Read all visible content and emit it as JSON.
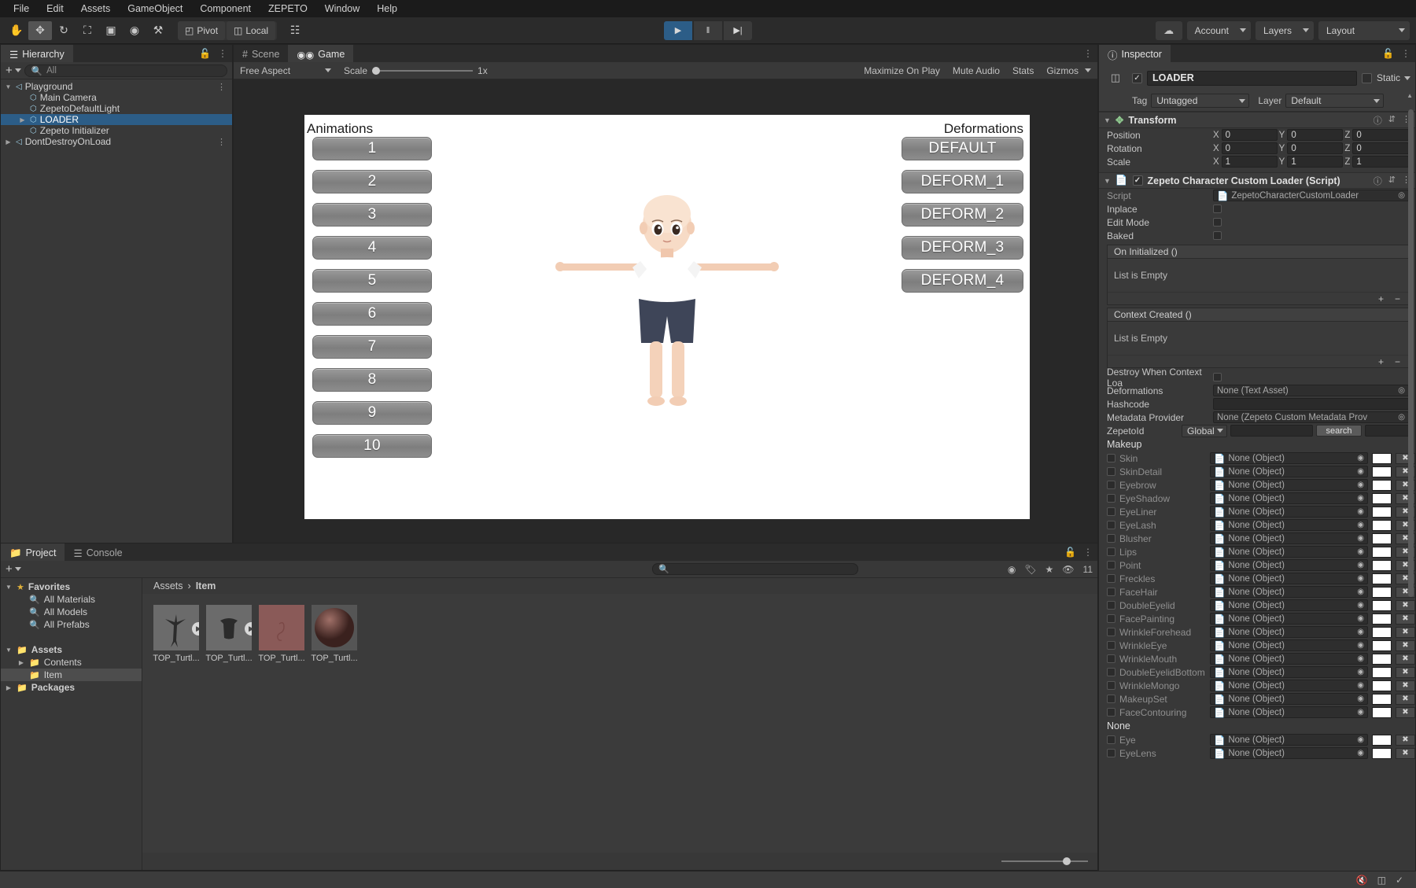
{
  "menu": {
    "items": [
      "File",
      "Edit",
      "Assets",
      "GameObject",
      "Component",
      "ZEPETO",
      "Window",
      "Help"
    ]
  },
  "toolbar": {
    "tools": [
      "hand-tool",
      "move-tool",
      "rotate-tool",
      "scale-tool",
      "rect-tool",
      "transform-tool",
      "custom-tool"
    ],
    "pivot_label": "Pivot",
    "local_label": "Local",
    "snap_label": "grid-snap",
    "play_label": "▶",
    "pause_label": "‖",
    "step_label": "▶|",
    "cloud_label": "cloud-icon",
    "account_label": "Account",
    "layers_label": "Layers",
    "layout_label": "Layout"
  },
  "hierarchy": {
    "tab_label": "Hierarchy",
    "search_placeholder": "All",
    "items": [
      {
        "label": "Playground",
        "depth": 1,
        "twisty": "▼",
        "icon": "scene-icon",
        "selected": false
      },
      {
        "label": "Main Camera",
        "depth": 2,
        "twisty": "",
        "icon": "gameobject-icon",
        "selected": false
      },
      {
        "label": "ZepetoDefaultLight",
        "depth": 2,
        "twisty": "",
        "icon": "gameobject-icon",
        "selected": false
      },
      {
        "label": "LOADER",
        "depth": 2,
        "twisty": "▶",
        "icon": "gameobject-icon",
        "selected": true
      },
      {
        "label": "Zepeto Initializer",
        "depth": 2,
        "twisty": "",
        "icon": "gameobject-icon",
        "selected": false
      },
      {
        "label": "DontDestroyOnLoad",
        "depth": 1,
        "twisty": "▶",
        "icon": "scene-icon",
        "selected": false
      }
    ]
  },
  "sceneview": {
    "tabs": [
      {
        "label": "Scene",
        "icon": "scene-hash-icon",
        "active": false
      },
      {
        "label": "Game",
        "icon": "game-pad-icon",
        "active": true
      }
    ],
    "aspect": "Free Aspect",
    "scale_label": "Scale",
    "scale_value": "1x",
    "right_items": [
      "Maximize On Play",
      "Mute Audio",
      "Stats",
      "Gizmos"
    ]
  },
  "game": {
    "animations_title": "Animations",
    "deformations_title": "Deformations",
    "animation_buttons": [
      "1",
      "2",
      "3",
      "4",
      "5",
      "6",
      "7",
      "8",
      "9",
      "10"
    ],
    "deform_buttons": [
      "DEFAULT",
      "DEFORM_1",
      "DEFORM_2",
      "DEFORM_3",
      "DEFORM_4"
    ]
  },
  "project": {
    "tabs": [
      {
        "label": "Project",
        "icon": "folder-icon",
        "active": true
      },
      {
        "label": "Console",
        "icon": "console-icon",
        "active": false
      }
    ],
    "search_placeholder": "",
    "hidden_count": "11",
    "tree": [
      {
        "label": "Favorites",
        "twisty": "▼",
        "icon": "star-icon",
        "depth": 0,
        "selected": false,
        "bold": true
      },
      {
        "label": "All Materials",
        "twisty": "",
        "icon": "search-icon",
        "depth": 1,
        "selected": false
      },
      {
        "label": "All Models",
        "twisty": "",
        "icon": "search-icon",
        "depth": 1,
        "selected": false
      },
      {
        "label": "All Prefabs",
        "twisty": "",
        "icon": "search-icon",
        "depth": 1,
        "selected": false
      },
      {
        "label": "",
        "twisty": "",
        "icon": "",
        "depth": 0,
        "selected": false
      },
      {
        "label": "Assets",
        "twisty": "▼",
        "icon": "folder-icon",
        "depth": 0,
        "selected": false,
        "bold": true
      },
      {
        "label": "Contents",
        "twisty": "▶",
        "icon": "folder-icon",
        "depth": 1,
        "selected": false
      },
      {
        "label": "Item",
        "twisty": "",
        "icon": "folder-icon",
        "depth": 1,
        "selected": true
      },
      {
        "label": "Packages",
        "twisty": "▶",
        "icon": "folder-icon",
        "depth": 0,
        "selected": false,
        "bold": true
      }
    ],
    "breadcrumb": [
      "Assets",
      "Item"
    ],
    "breadcrumb_sep": "›",
    "assets": [
      {
        "name": "TOP_Turtl...",
        "kind": "model-dark",
        "has_play": true
      },
      {
        "name": "TOP_Turtl...",
        "kind": "model-shirt",
        "has_play": true
      },
      {
        "name": "TOP_Turtl...",
        "kind": "texture-red",
        "has_play": false
      },
      {
        "name": "TOP_Turtl...",
        "kind": "material-sphere",
        "has_play": false
      }
    ]
  },
  "inspector": {
    "tab_label": "Inspector",
    "object_name": "LOADER",
    "static_label": "Static",
    "tag_label": "Tag",
    "tag_value": "Untagged",
    "layer_label": "Layer",
    "layer_value": "Default",
    "transform": {
      "title": "Transform",
      "rows": [
        {
          "label": "Position",
          "x": "0",
          "y": "0",
          "z": "0"
        },
        {
          "label": "Rotation",
          "x": "0",
          "y": "0",
          "z": "0"
        },
        {
          "label": "Scale",
          "x": "1",
          "y": "1",
          "z": "1"
        }
      ],
      "axes": [
        "X",
        "Y",
        "Z"
      ]
    },
    "script_component": {
      "title": "Zepeto Character Custom Loader (Script)",
      "script_label": "Script",
      "script_value": "ZepetoCharacterCustomLoader",
      "checkboxes": [
        {
          "label": "Inplace",
          "checked": false
        },
        {
          "label": "Edit Mode",
          "checked": false
        },
        {
          "label": "Baked",
          "checked": false
        }
      ],
      "events": [
        {
          "title": "On Initialized ()",
          "empty_text": "List is Empty",
          "add": "+",
          "remove": "−"
        },
        {
          "title": "Context Created ()",
          "empty_text": "List is Empty",
          "add": "+",
          "remove": "−"
        }
      ],
      "destroy_label": "Destroy When Context Loa",
      "deformations_label": "Deformations",
      "deformations_value": "None (Text Asset)",
      "hashcode_label": "Hashcode",
      "hashcode_value": "",
      "metadata_label": "Metadata Provider",
      "metadata_value": "None (Zepeto Custom Metadata Prov",
      "zepetoid_label": "ZepetoId",
      "zepetoid_scope": "Global",
      "zepetoid_value": "",
      "search_label": "search",
      "makeup_label": "Makeup",
      "none_label": "None",
      "object_placeholder": "None (Object)",
      "makeup_rows": [
        "Skin",
        "SkinDetail",
        "Eyebrow",
        "EyeShadow",
        "EyeLiner",
        "EyeLash",
        "Blusher",
        "Lips",
        "Point",
        "Freckles",
        "FaceHair",
        "DoubleEyelid",
        "FacePainting",
        "WrinkleForehead",
        "WrinkleEye",
        "WrinkleMouth",
        "DoubleEyelidBottom",
        "WrinkleMongo",
        "MakeupSet",
        "FaceContouring"
      ],
      "none_rows": [
        "Eye",
        "EyeLens"
      ]
    }
  },
  "colors": {
    "accent_blue": "#2c5d87",
    "panel_bg": "#383838",
    "toolbar_bg": "#2b2b2b",
    "menu_bg": "#1b1b1b",
    "game_bg": "#282828"
  }
}
